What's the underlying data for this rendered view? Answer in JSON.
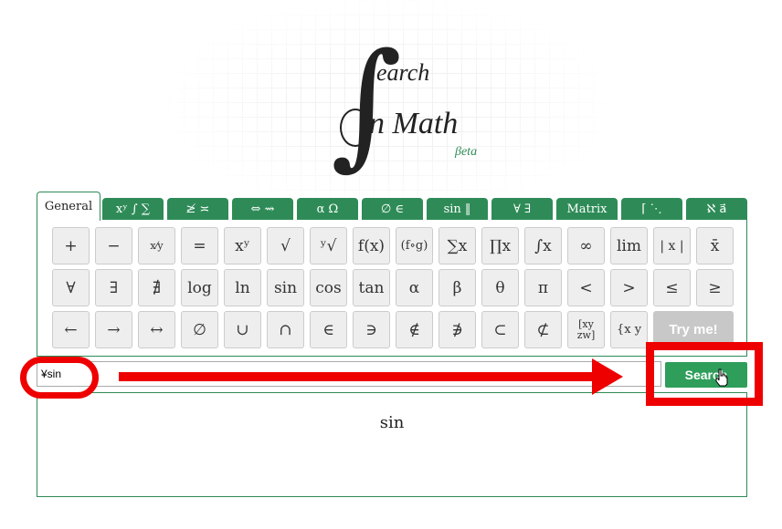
{
  "logo": {
    "earch": "earch",
    "n_math": "n Math",
    "beta": "βeta"
  },
  "tabs": [
    "General",
    "xʸ ∫ ∑",
    "≱ ≍",
    "⇔ ⇝",
    "α Ω",
    "∅ ∈",
    "sin ‖",
    "∀ ∃",
    "Matrix",
    "⌈ ⋱",
    "ℵ a⃗"
  ],
  "keys_row1": [
    "+",
    "−",
    "x⁄y",
    "=",
    "xʸ",
    "√",
    "ʸ√",
    "f(x)",
    "(f∘g)",
    "∑x",
    "∏x",
    "∫x",
    "∞",
    "lim",
    "| x |",
    "x̄"
  ],
  "keys_row2": [
    "∀",
    "∃",
    "∄",
    "log",
    "ln",
    "sin",
    "cos",
    "tan",
    "α",
    "β",
    "θ",
    "π",
    "<",
    ">",
    "≤",
    "≥"
  ],
  "keys_row3": [
    "←",
    "→",
    "↔",
    "∅",
    "∪",
    "∩",
    "∈",
    "∋",
    "∉",
    "∌",
    "⊂",
    "⊄",
    "[xy zw]",
    "{x y"
  ],
  "try_label": "Try me!",
  "search": {
    "value": "¥sin",
    "button": "Search"
  },
  "preview_text": "sin"
}
